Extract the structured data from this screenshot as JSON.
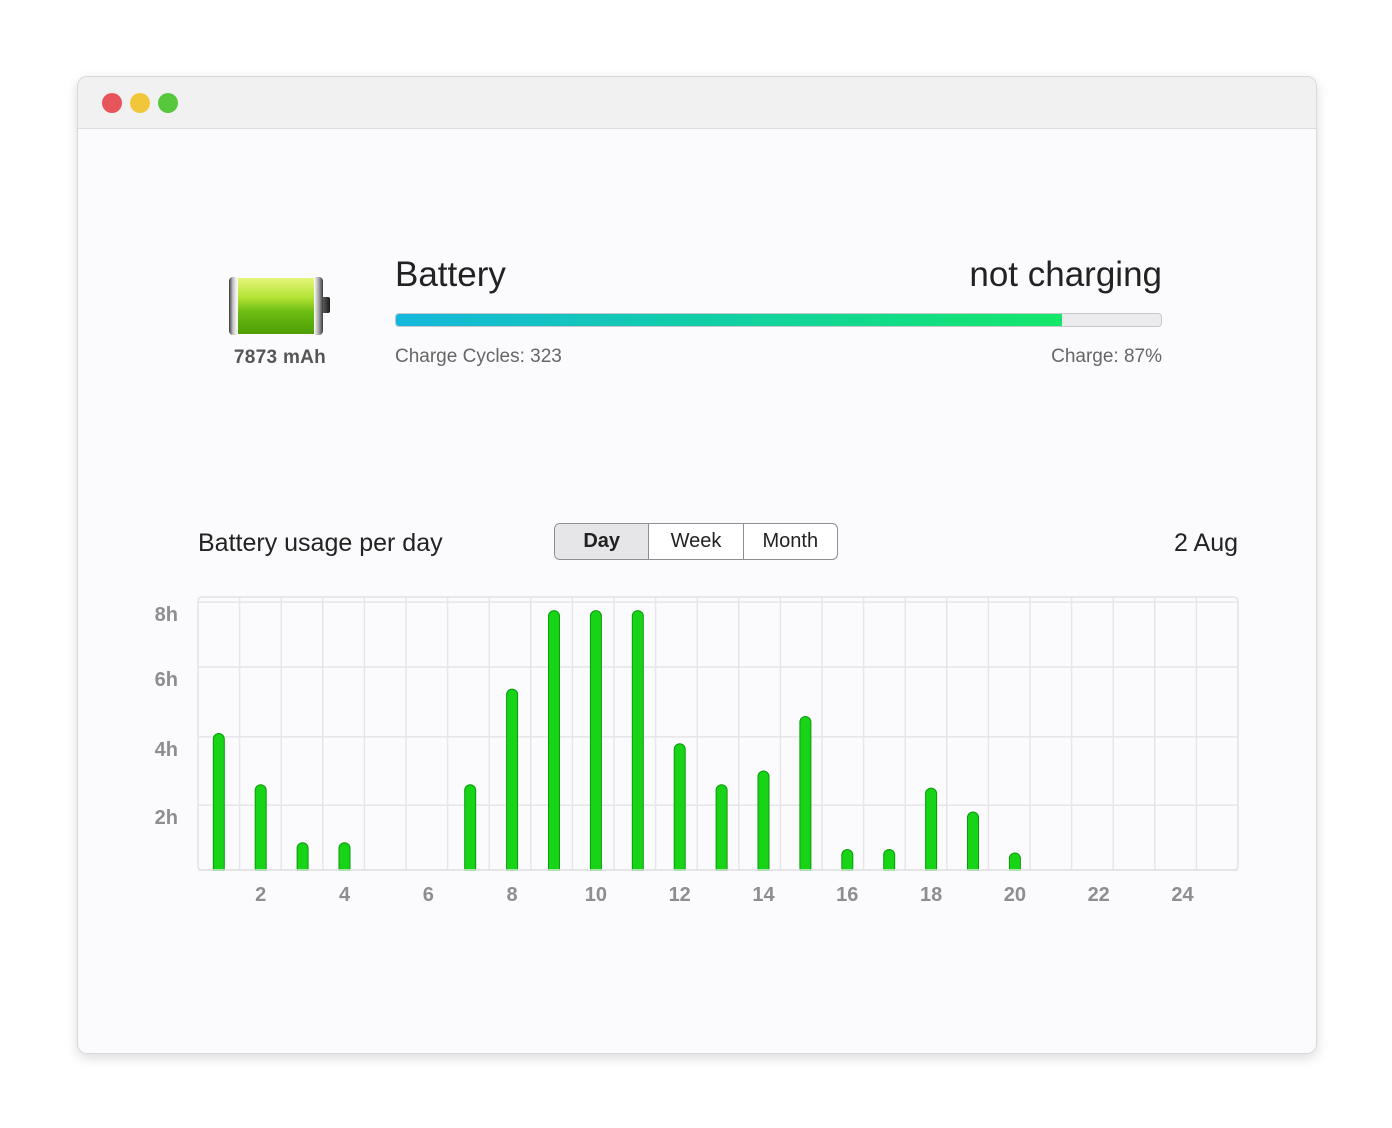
{
  "window": {
    "controls": [
      "close",
      "minimize",
      "zoom"
    ]
  },
  "battery": {
    "icon": "battery-full-icon",
    "capacity": "7873 mAh",
    "title": "Battery",
    "status": "not charging",
    "charge_fraction": 0.87,
    "charge_cycles_text": "Charge Cycles: 323",
    "charge_text": "Charge: 87%"
  },
  "usage": {
    "title": "Battery usage per day",
    "tabs": [
      "Day",
      "Week",
      "Month"
    ],
    "active_tab": "Day",
    "date": "2 Aug"
  },
  "colors": {
    "bar": "#17d417",
    "bar_stroke": "#0a9a0a",
    "progress_start": "#13b8dc",
    "progress_end": "#12e86a"
  },
  "chart_data": {
    "type": "bar",
    "x": [
      1,
      2,
      3,
      4,
      5,
      6,
      7,
      8,
      9,
      10,
      11,
      12,
      13,
      14,
      15,
      16,
      17,
      18,
      19,
      20,
      21,
      22,
      23,
      24
    ],
    "values": [
      4.0,
      2.5,
      0.8,
      0.8,
      0,
      0,
      2.5,
      5.3,
      7.6,
      7.6,
      7.6,
      3.7,
      2.5,
      2.9,
      4.5,
      0.6,
      0.6,
      2.4,
      1.7,
      0.5,
      0,
      0,
      0,
      0
    ],
    "xticks": [
      "2",
      "4",
      "6",
      "8",
      "10",
      "12",
      "14",
      "16",
      "18",
      "20",
      "22",
      "24"
    ],
    "yticks": [
      "2h",
      "4h",
      "6h",
      "8h"
    ],
    "ylim": [
      0,
      8
    ],
    "grid": true
  }
}
